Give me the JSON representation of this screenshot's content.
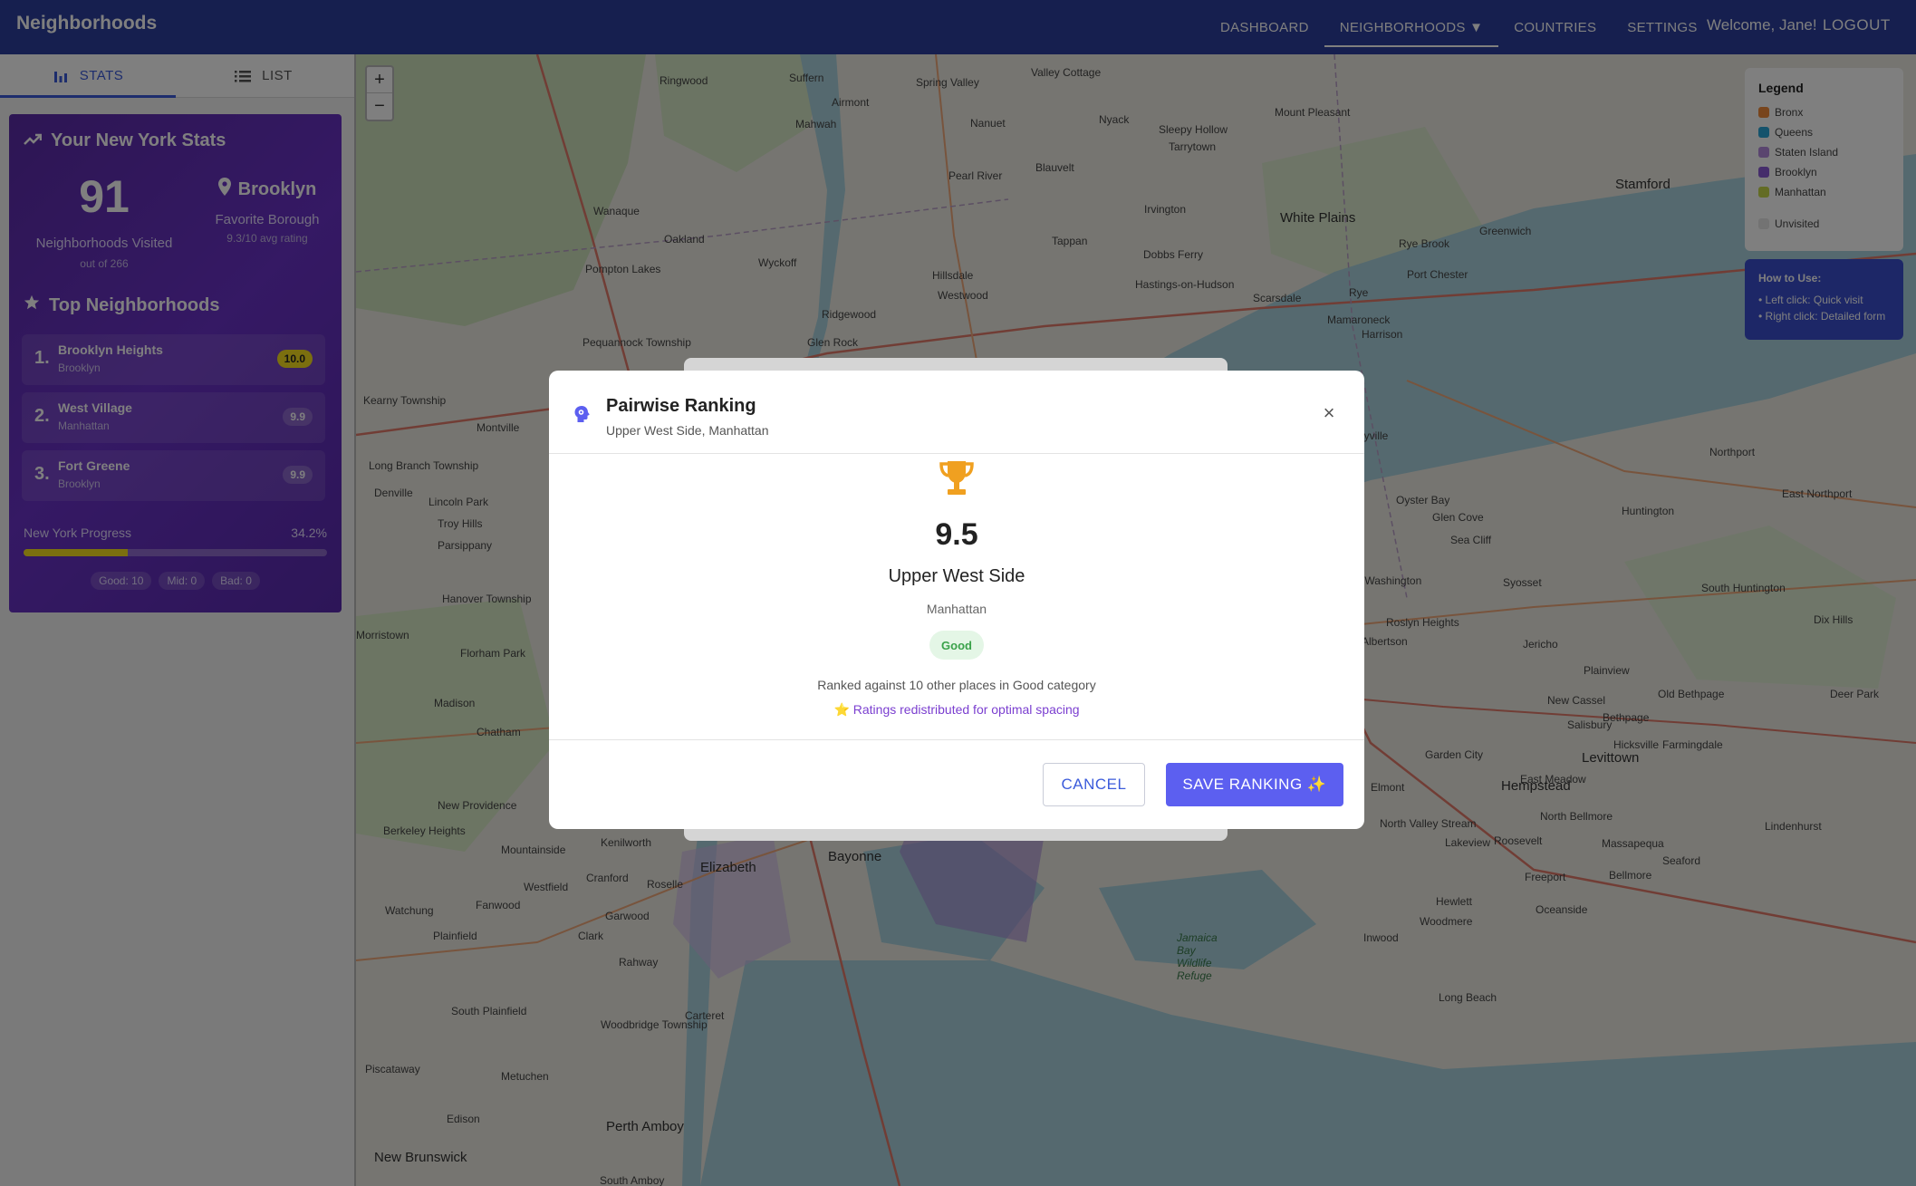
{
  "topbar": {
    "brand": "Neighborhoods",
    "nav": [
      "DASHBOARD",
      "NEIGHBORHOODS ▼",
      "COUNTRIES",
      "SETTINGS"
    ],
    "welcome": "Welcome, Jane!",
    "logout": "LOGOUT"
  },
  "sidebar": {
    "tabs": [
      "STATS",
      "LIST"
    ],
    "stats_title": "Your New York Stats",
    "visited_count": "91",
    "visited_label": "Neighborhoods Visited",
    "visited_sub": "out of 266",
    "favorite_name": "Brooklyn",
    "favorite_label": "Favorite Borough",
    "favorite_sub": "9.3/10 avg rating",
    "top_title": "Top Neighborhoods",
    "top": [
      {
        "rank": "1.",
        "name": "Brooklyn Heights",
        "borough": "Brooklyn",
        "score": "10.0"
      },
      {
        "rank": "2.",
        "name": "West Village",
        "borough": "Manhattan",
        "score": "9.9"
      },
      {
        "rank": "3.",
        "name": "Fort Greene",
        "borough": "Brooklyn",
        "score": "9.9"
      }
    ],
    "progress_label": "New York Progress",
    "progress_pct": "34.2%",
    "progress_value": 0.342,
    "chips": [
      "Good: 10",
      "Mid: 0",
      "Bad: 0"
    ]
  },
  "map": {
    "zoom_in": "+",
    "zoom_out": "−",
    "places": [
      "Suffern",
      "Airmont",
      "Spring Valley",
      "Valley Cottage",
      "Mahwah",
      "Nanuet",
      "Nyack",
      "Sleepy Hollow",
      "Tarrytown",
      "Mount Pleasant",
      "Ringwood",
      "Oakland",
      "Wanaque",
      "Wyckoff",
      "Pearl River",
      "Blauvelt",
      "Irvington",
      "White Plains",
      "Stamford",
      "Rye Brook",
      "Greenwich",
      "Pompton Lakes",
      "Mamaroneck",
      "Rye",
      "Dobbs Ferry",
      "Hastings-on-Hudson",
      "Scarsdale",
      "Harrison",
      "Port Chester",
      "Ridgewood",
      "Hillsdale",
      "Westwood",
      "Tappan",
      "Glen Rock",
      "Pequannock Township",
      "Montville",
      "Bayville",
      "Oyster Bay",
      "Huntington",
      "Northport",
      "East Northport",
      "Glen Cove",
      "Sea Cliff",
      "Port Washington",
      "Syosset",
      "South Huntington",
      "Dix Hills",
      "Jericho",
      "Plainview",
      "Old Bethpage",
      "Deer Park",
      "Bethpage",
      "Farmingdale",
      "Levittown",
      "Hempstead",
      "Garden City",
      "East Meadow",
      "North Bellmore",
      "Massapequa",
      "Seaford",
      "Lindenhurst",
      "Bellmore",
      "Freeport",
      "Elmont",
      "North Valley Stream",
      "Lakeview",
      "Roosevelt",
      "Oceanside",
      "Hewlett",
      "Woodmere",
      "Inwood",
      "Long Beach",
      "Jamaica Bay Wildlife Refuge",
      "Albertson",
      "Roslyn Heights",
      "New Cassel",
      "Salisbury",
      "Hicksville",
      "Elizabeth",
      "Bayonne",
      "Kenilworth",
      "Cranford",
      "Roselle",
      "Westfield",
      "Fanwood",
      "Garwood",
      "Clark",
      "Rahway",
      "Carteret",
      "Woodbridge Township",
      "Metuchen",
      "Edison",
      "Perth Amboy",
      "New Brunswick",
      "South Amboy",
      "Piscataway",
      "South Plainfield",
      "Plainfield",
      "Watchung",
      "Berkeley Heights",
      "New Providence",
      "Mountainside",
      "Chatham",
      "Florham Park",
      "Madison",
      "Hanover Township",
      "Morristown",
      "Parsippany",
      "Troy Hills",
      "Lincoln Park",
      "Denville",
      "Long Branch Township",
      "Kearny Township"
    ],
    "legend_title": "Legend",
    "legend": [
      {
        "label": "Bronx",
        "color": "#f08a3a"
      },
      {
        "label": "Queens",
        "color": "#2aa6d8"
      },
      {
        "label": "Staten Island",
        "color": "#b48adf"
      },
      {
        "label": "Brooklyn",
        "color": "#8a5bd6"
      },
      {
        "label": "Manhattan",
        "color": "#c6d94a"
      }
    ],
    "legend_unvisited": "Unvisited",
    "legend_unvisited_color": "#e6e6e6",
    "howto_title": "How to Use:",
    "howto_lines": [
      "• Left click: Quick visit",
      "• Right click: Detailed form"
    ]
  },
  "modal": {
    "title": "Pairwise Ranking",
    "subtitle": "Upper West Side, Manhattan",
    "close": "×",
    "score": "9.5",
    "name": "Upper West Side",
    "borough": "Manhattan",
    "badge": "Good",
    "ranked_text": "Ranked against 10 other places in Good category",
    "redistributed_text": "⭐ Ratings redistributed for optimal spacing",
    "cancel": "CANCEL",
    "save": "SAVE RANKING ✨",
    "accent": "#5c5ff0",
    "trophy_color": "#f0a020"
  }
}
